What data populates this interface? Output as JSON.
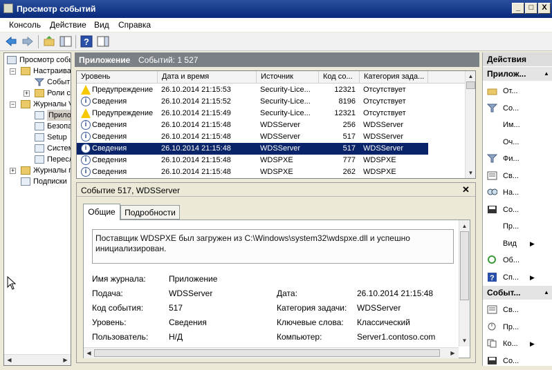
{
  "window": {
    "title": "Просмотр событий",
    "min": "_",
    "max": "□",
    "close": "X"
  },
  "menu": [
    "Консоль",
    "Действие",
    "Вид",
    "Справка"
  ],
  "tree": [
    {
      "label": "Просмотр событ",
      "depth": 0
    },
    {
      "label": "Настраива",
      "depth": 1,
      "exp": "−"
    },
    {
      "label": "События",
      "depth": 2
    },
    {
      "label": "Роли се",
      "depth": 2,
      "exp": "+"
    },
    {
      "label": "Журналы V",
      "depth": 1,
      "exp": "−"
    },
    {
      "label": "Прилож",
      "depth": 2
    },
    {
      "label": "Безопа",
      "depth": 2
    },
    {
      "label": "Setup",
      "depth": 2
    },
    {
      "label": "Систем",
      "depth": 2
    },
    {
      "label": "Пересл",
      "depth": 2
    },
    {
      "label": "Журналы п",
      "depth": 1,
      "exp": "+"
    },
    {
      "label": "Подписки",
      "depth": 1
    }
  ],
  "center": {
    "header_title": "Приложение",
    "header_count": "Событий: 1 527"
  },
  "grid": {
    "columns": [
      "Уровень",
      "Дата и время",
      "Источник",
      "Код со...",
      "Категория зада..."
    ],
    "rows": [
      {
        "level": "Предупреждение",
        "type": "warn",
        "date": "26.10.2014 21:15:53",
        "source": "Security-Lice...",
        "code": "12321",
        "category": "Отсутствует"
      },
      {
        "level": "Сведения",
        "type": "info",
        "date": "26.10.2014 21:15:52",
        "source": "Security-Lice...",
        "code": "8196",
        "category": "Отсутствует"
      },
      {
        "level": "Предупреждение",
        "type": "warn",
        "date": "26.10.2014 21:15:49",
        "source": "Security-Lice...",
        "code": "12321",
        "category": "Отсутствует"
      },
      {
        "level": "Сведения",
        "type": "info",
        "date": "26.10.2014 21:15:48",
        "source": "WDSServer",
        "code": "256",
        "category": "WDSServer"
      },
      {
        "level": "Сведения",
        "type": "info",
        "date": "26.10.2014 21:15:48",
        "source": "WDSServer",
        "code": "517",
        "category": "WDSServer"
      },
      {
        "level": "Сведения",
        "type": "info",
        "date": "26.10.2014 21:15:48",
        "source": "WDSServer",
        "code": "517",
        "category": "WDSServer",
        "selected": true
      },
      {
        "level": "Сведения",
        "type": "info",
        "date": "26.10.2014 21:15:48",
        "source": "WDSPXE",
        "code": "777",
        "category": "WDSPXE"
      },
      {
        "level": "Сведения",
        "type": "info",
        "date": "26.10.2014 21:15:48",
        "source": "WDSPXE",
        "code": "262",
        "category": "WDSPXE"
      }
    ]
  },
  "detail": {
    "title": "Событие 517, WDSServer",
    "close": "✕",
    "tab_general": "Общие",
    "tab_details": "Подробности",
    "description": "Поставщик WDSPXE был загружен из C:\\Windows\\system32\\wdspxe.dll и успешно инициализирован.",
    "fields": {
      "log_name_label": "Имя журнала:",
      "log_name": "Приложение",
      "source_label": "Подача:",
      "source": "WDSServer",
      "date_label": "Дата:",
      "date": "26.10.2014 21:15:48",
      "event_id_label": "Код события:",
      "event_id": "517",
      "task_label": "Категория задачи:",
      "task": "WDSServer",
      "level_label": "Уровень:",
      "level": "Сведения",
      "keywords_label": "Ключевые слова:",
      "keywords": "Классический",
      "user_label": "Пользователь:",
      "user": "Н/Д",
      "computer_label": "Компьютер:",
      "computer": "Server1.contoso.com"
    }
  },
  "actions": {
    "title": "Действия",
    "section1": "Прилож...",
    "section1_items": [
      {
        "label": "От...",
        "icon": "open-log-icon"
      },
      {
        "label": "Со...",
        "icon": "filter-icon"
      },
      {
        "label": "Им...",
        "icon": "none"
      },
      {
        "label": "Оч...",
        "icon": "none"
      },
      {
        "label": "Фи...",
        "icon": "filter-icon"
      },
      {
        "label": "Св...",
        "icon": "properties-icon"
      },
      {
        "label": "На...",
        "icon": "find-icon"
      },
      {
        "label": "Со...",
        "icon": "save-icon"
      },
      {
        "label": "Пр...",
        "icon": "none"
      },
      {
        "label": "Вид",
        "icon": "none",
        "sub": true
      },
      {
        "label": "Об...",
        "icon": "refresh-icon"
      },
      {
        "label": "Сп...",
        "icon": "help-icon",
        "sub": true
      }
    ],
    "section2": "Событ...",
    "section2_items": [
      {
        "label": "Св...",
        "icon": "properties-icon"
      },
      {
        "label": "Пр...",
        "icon": "attach-task-icon"
      },
      {
        "label": "Ко...",
        "icon": "copy-icon",
        "sub": true
      },
      {
        "label": "Со...",
        "icon": "save-icon"
      }
    ]
  }
}
